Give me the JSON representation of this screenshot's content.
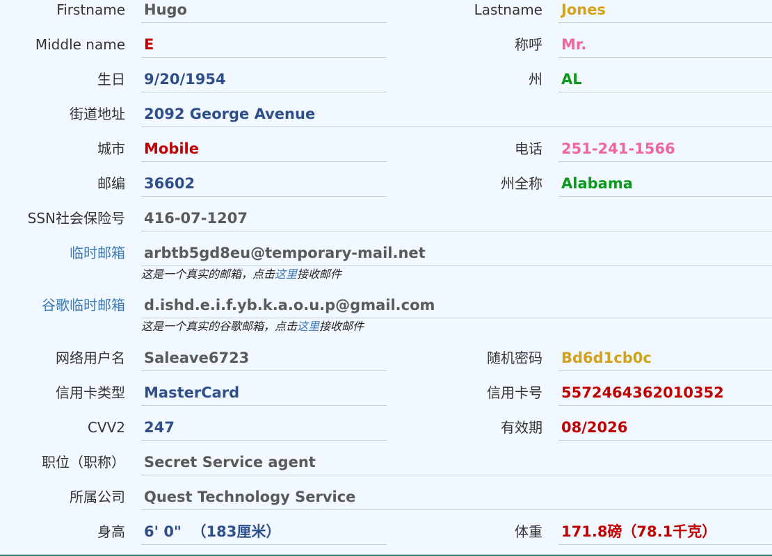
{
  "rows": {
    "firstname": {
      "label": "Firstname",
      "value": "Hugo"
    },
    "lastname": {
      "label": "Lastname",
      "value": "Jones"
    },
    "middle_name": {
      "label": "Middle name",
      "value": "E"
    },
    "title": {
      "label": "称呼",
      "value": "Mr."
    },
    "birthday": {
      "label": "生日",
      "value": "9/20/1954"
    },
    "state": {
      "label": "州",
      "value": "AL"
    },
    "street": {
      "label": "街道地址",
      "value": "2092 George Avenue"
    },
    "city": {
      "label": "城市",
      "value": "Mobile"
    },
    "phone": {
      "label": "电话",
      "value": "251-241-1566"
    },
    "zip": {
      "label": "邮编",
      "value": "36602"
    },
    "state_full": {
      "label": "州全称",
      "value": "Alabama"
    },
    "ssn": {
      "label": "SSN社会保险号",
      "value": "416-07-1207"
    },
    "temp_email": {
      "label": "临时邮箱",
      "value": "arbtb5gd8eu@temporary-mail.net",
      "note_prefix": "这是一个真实的邮箱，点击",
      "note_link": "这里",
      "note_suffix": "接收邮件"
    },
    "google_email": {
      "label": "谷歌临时邮箱",
      "value": "d.ishd.e.i.f.yb.k.a.o.u.p@gmail.com",
      "note_prefix": "这是一个真实的谷歌邮箱，点击",
      "note_link": "这里",
      "note_suffix": "接收邮件"
    },
    "username": {
      "label": "网络用户名",
      "value": "Saleave6723"
    },
    "password": {
      "label": "随机密码",
      "value": "Bd6d1cb0c"
    },
    "card_type": {
      "label": "信用卡类型",
      "value": "MasterCard"
    },
    "card_number": {
      "label": "信用卡号",
      "value": "5572464362010352"
    },
    "cvv2": {
      "label": "CVV2",
      "value": "247"
    },
    "expiry": {
      "label": "有效期",
      "value": "08/2026"
    },
    "occupation": {
      "label": "职位（职称）",
      "value": "Secret Service agent"
    },
    "company": {
      "label": "所属公司",
      "value": "Quest Technology Service"
    },
    "height": {
      "label": "身高",
      "value": "6' 0\"  （183厘米）"
    },
    "weight": {
      "label": "体重",
      "value": "171.8磅（78.1千克）"
    }
  },
  "colors": {
    "background": "#f1f8ff",
    "label": "#333333",
    "link": "#3a7ab8",
    "gray": "#5a5a5a",
    "blue": "#2f4f8a",
    "red": "#c00000",
    "gold": "#d3a21b",
    "pink": "#f0669a",
    "green": "#0a9a1a"
  }
}
